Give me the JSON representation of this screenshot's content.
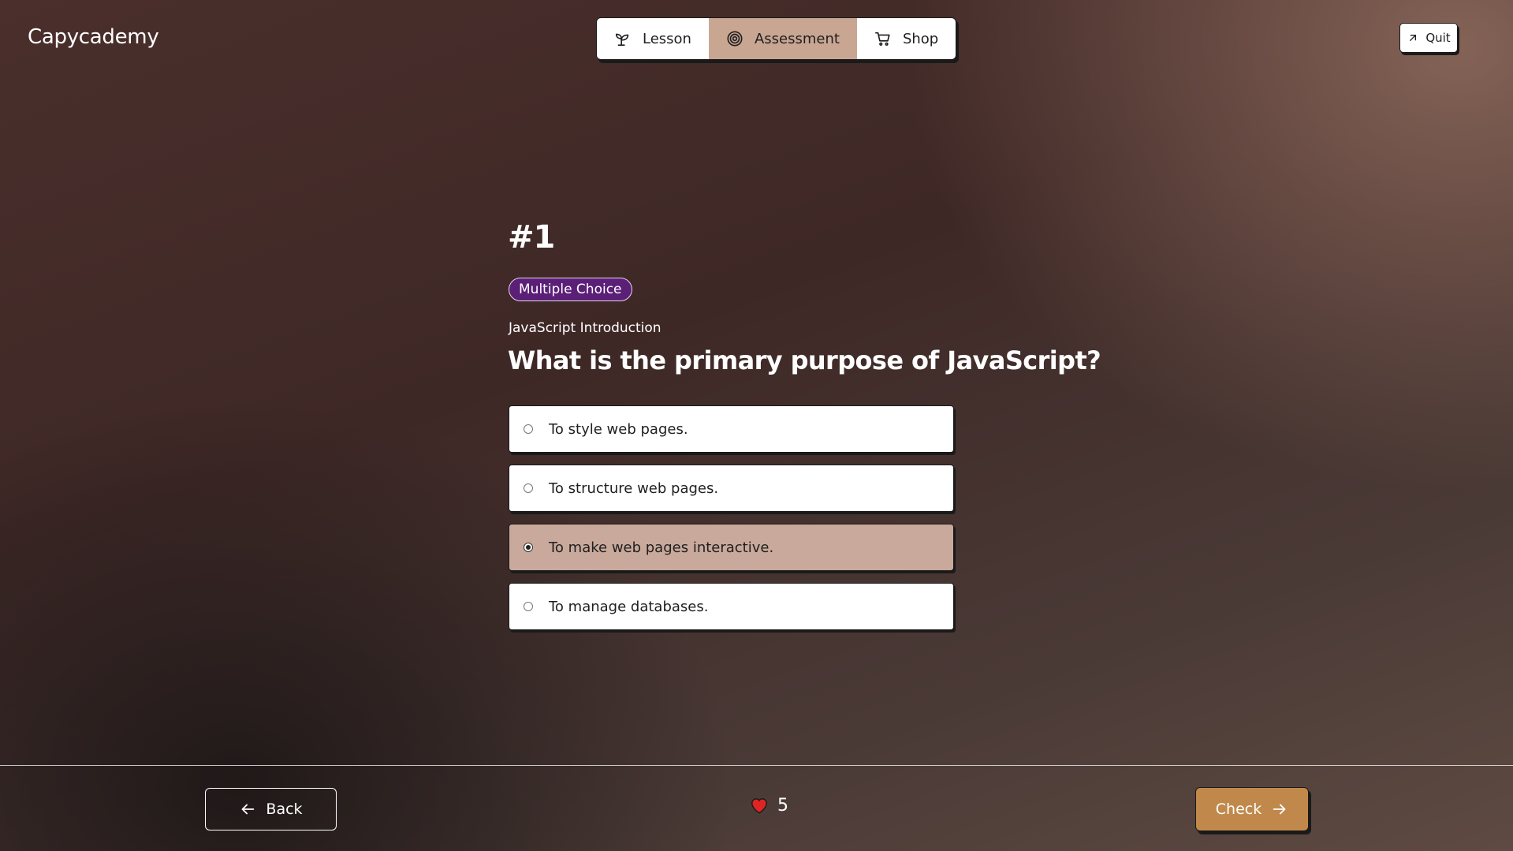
{
  "app": {
    "name": "Capycademy"
  },
  "nav": {
    "items": [
      {
        "label": "Lesson",
        "icon": "sprout-icon",
        "active": false
      },
      {
        "label": "Assessment",
        "icon": "target-icon",
        "active": true
      },
      {
        "label": "Shop",
        "icon": "cart-icon",
        "active": false
      }
    ]
  },
  "quit": {
    "label": "Quit",
    "icon": "arrow-up-right-icon"
  },
  "question": {
    "number": "#1",
    "type_badge": "Multiple Choice",
    "topic": "JavaScript Introduction",
    "text": "What is the primary purpose of JavaScript?",
    "options": [
      {
        "label": "To style web pages.",
        "selected": false
      },
      {
        "label": "To structure web pages.",
        "selected": false
      },
      {
        "label": "To make web pages interactive.",
        "selected": true
      },
      {
        "label": "To manage databases.",
        "selected": false
      }
    ]
  },
  "footer": {
    "back_label": "Back",
    "lives": "5",
    "check_label": "Check"
  },
  "colors": {
    "active_tab": "#c9a692",
    "selected_option": "#c9a99b",
    "badge": "#5b1f78",
    "check_button": "#c0894b",
    "heart": "#e02424"
  }
}
